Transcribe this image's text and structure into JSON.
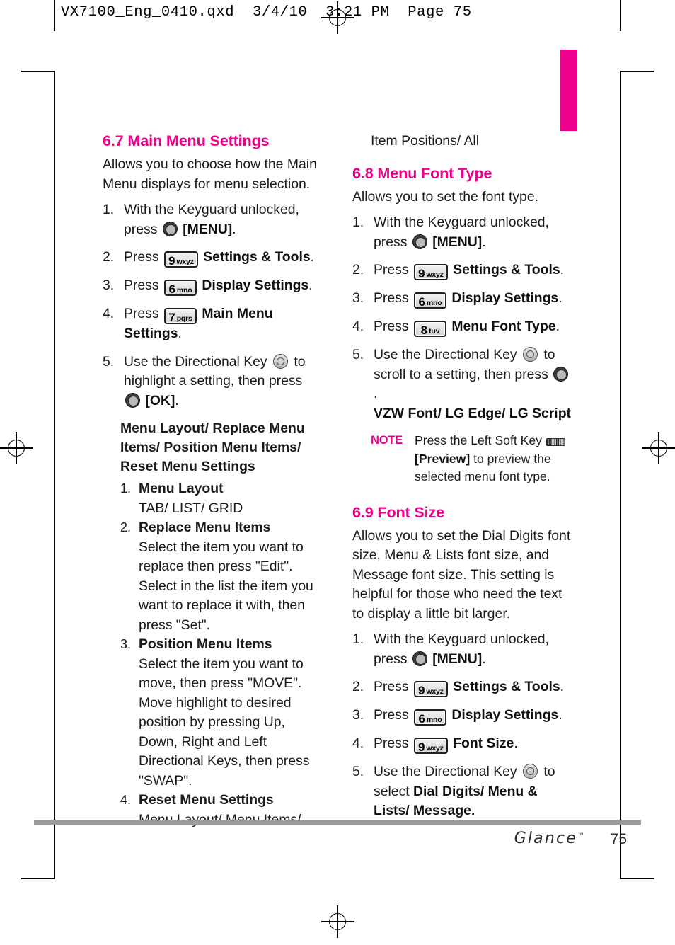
{
  "prepress": {
    "file_header": "VX7100_Eng_0410.qxd  3/4/10  3:21 PM  Page 75"
  },
  "footer": {
    "brand": "Glance",
    "trademark": "™",
    "page_number": "75"
  },
  "left_column": {
    "section": {
      "heading": "6.7 Main Menu Settings",
      "intro": "Allows you to choose how the Main Menu displays for menu selection."
    },
    "steps": [
      {
        "num": "1.",
        "pre": "With the Keyguard unlocked, press",
        "icon": "ok-key",
        "bold": "[MENU]",
        "post": "."
      },
      {
        "num": "2.",
        "pre": "Press",
        "icon": "keypad-9",
        "key_digit": "9",
        "key_letters": "wxyz",
        "bold": "Settings & Tools",
        "post": "."
      },
      {
        "num": "3.",
        "pre": "Press",
        "icon": "keypad-6",
        "key_digit": "6",
        "key_letters": "mno",
        "bold": "Display Settings",
        "post": "."
      },
      {
        "num": "4.",
        "pre": "Press",
        "icon": "keypad-7",
        "key_digit": "7",
        "key_letters": "pqrs",
        "bold": "Main Menu Settings",
        "post": "."
      },
      {
        "num": "5.",
        "pre": "Use the Directional Key",
        "icon": "directional-key",
        "mid": "to highlight a setting, then press",
        "icon2": "ok-key",
        "bold": "[OK]",
        "post": "."
      }
    ],
    "sub_block": {
      "lead": "Menu Layout/ Replace Menu Items/ Position Menu Items/ Reset Menu Settings",
      "items": [
        {
          "num": "1.",
          "title": "Menu Layout",
          "desc": "TAB/ LIST/ GRID"
        },
        {
          "num": "2.",
          "title": "Replace Menu Items",
          "desc": "Select the item you want to replace then press \"Edit\". Select in the list the item you want to replace it with, then press \"Set\"."
        },
        {
          "num": "3.",
          "title": "Position Menu Items",
          "desc": "Select the item you want to move, then press \"MOVE\". Move highlight to desired position by pressing Up, Down, Right and Left Directional Keys, then press \"SWAP\"."
        },
        {
          "num": "4.",
          "title": "Reset Menu Settings",
          "desc": "Menu Layout/ Menu Items/"
        }
      ]
    }
  },
  "right_column": {
    "continued_line": "Item Positions/ All",
    "section_font_type": {
      "heading": "6.8 Menu Font Type",
      "intro": "Allows you to set the font type.",
      "steps": [
        {
          "num": "1.",
          "pre": "With the Keyguard unlocked, press",
          "icon": "ok-key",
          "bold": "[MENU]",
          "post": "."
        },
        {
          "num": "2.",
          "pre": "Press",
          "icon": "keypad-9",
          "key_digit": "9",
          "key_letters": "wxyz",
          "bold": "Settings & Tools",
          "post": "."
        },
        {
          "num": "3.",
          "pre": "Press",
          "icon": "keypad-6",
          "key_digit": "6",
          "key_letters": "mno",
          "bold": "Display Settings",
          "post": "."
        },
        {
          "num": "4.",
          "pre": "Press",
          "icon": "keypad-8",
          "key_digit": "8",
          "key_letters": "tuv",
          "bold": "Menu Font Type",
          "post": "."
        },
        {
          "num": "5.",
          "pre": "Use the Directional Key",
          "icon": "directional-key",
          "mid": "to scroll to a setting, then press",
          "icon2": "ok-key",
          "post": ".",
          "options": "VZW Font/ LG Edge/ LG Script"
        }
      ],
      "note": {
        "label": "NOTE",
        "text_before": "Press the Left Soft Key",
        "icon": "soft-key",
        "bold": "[Preview]",
        "text_after": "to preview the selected menu font type."
      }
    },
    "section_font_size": {
      "heading": "6.9 Font Size",
      "intro": "Allows you to set the Dial Digits font size, Menu & Lists font size, and Message font size. This setting is helpful for those who need the text to display a little bit larger.",
      "steps": [
        {
          "num": "1.",
          "pre": "With the Keyguard unlocked, press",
          "icon": "ok-key",
          "bold": "[MENU]",
          "post": "."
        },
        {
          "num": "2.",
          "pre": "Press",
          "icon": "keypad-9",
          "key_digit": "9",
          "key_letters": "wxyz",
          "bold": "Settings & Tools",
          "post": "."
        },
        {
          "num": "3.",
          "pre": "Press",
          "icon": "keypad-6",
          "key_digit": "6",
          "key_letters": "mno",
          "bold": "Display Settings",
          "post": "."
        },
        {
          "num": "4.",
          "pre": "Press",
          "icon": "keypad-9",
          "key_digit": "9",
          "key_letters": "wxyz",
          "bold": "Font Size",
          "post": "."
        },
        {
          "num": "5.",
          "pre": "Use the Directional Key",
          "icon": "directional-key",
          "mid": "to select",
          "bold": "Dial Digits/ Menu & Lists/ Message."
        }
      ]
    }
  },
  "colors": {
    "accent_pink": "#EC008C",
    "body_text": "#1b1b1b",
    "footer_rule": "#9b9b9b"
  }
}
